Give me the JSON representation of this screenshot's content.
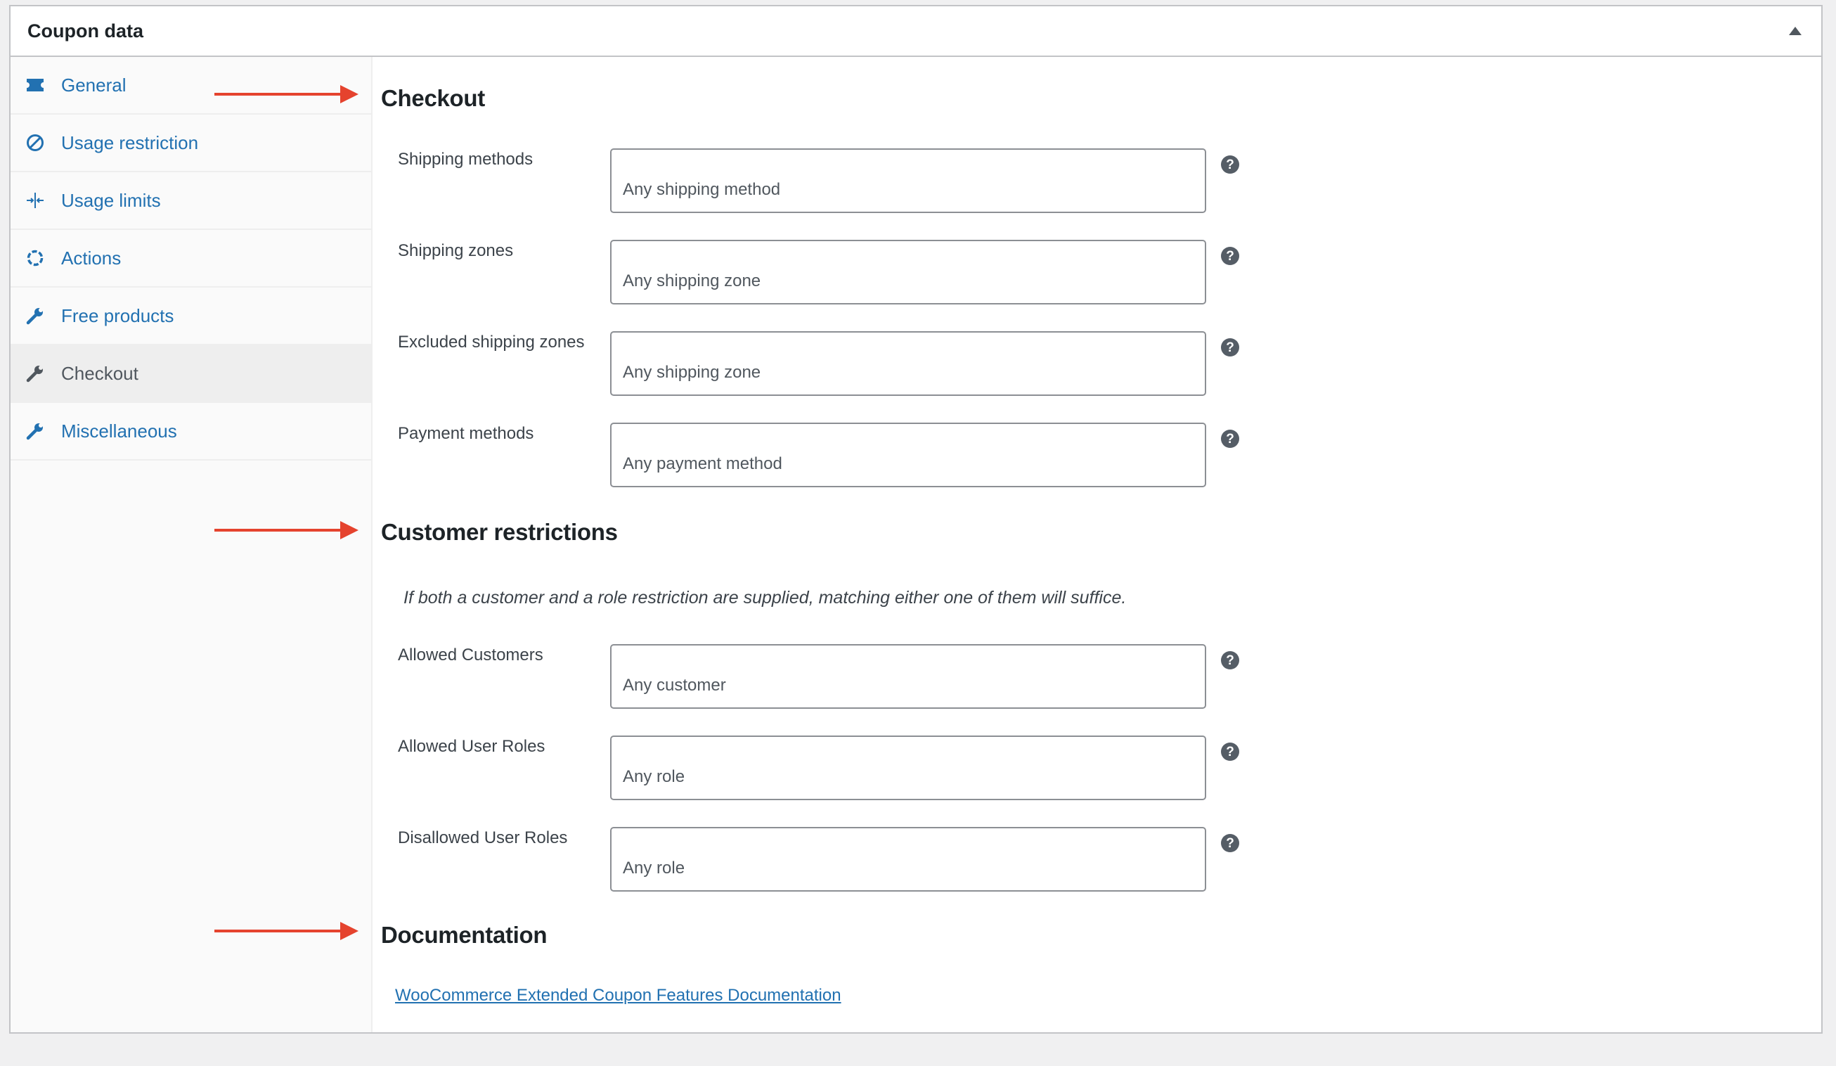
{
  "panel": {
    "title": "Coupon data"
  },
  "tabs": [
    {
      "label": "General",
      "icon": "ticket-icon",
      "active": false
    },
    {
      "label": "Usage restriction",
      "icon": "no-entry-icon",
      "active": false
    },
    {
      "label": "Usage limits",
      "icon": "limits-icon",
      "active": false
    },
    {
      "label": "Actions",
      "icon": "actions-icon",
      "active": false
    },
    {
      "label": "Free products",
      "icon": "wrench-icon",
      "active": false
    },
    {
      "label": "Checkout",
      "icon": "wrench-icon",
      "active": true
    },
    {
      "label": "Miscellaneous",
      "icon": "wrench-icon",
      "active": false
    }
  ],
  "checkout": {
    "heading": "Checkout",
    "fields": [
      {
        "label": "Shipping methods",
        "placeholder": "Any shipping method"
      },
      {
        "label": "Shipping zones",
        "placeholder": "Any shipping zone"
      },
      {
        "label": "Excluded shipping zones",
        "placeholder": "Any shipping zone"
      },
      {
        "label": "Payment methods",
        "placeholder": "Any payment method"
      }
    ]
  },
  "customer_restrictions": {
    "heading": "Customer restrictions",
    "note": "If both a customer and a role restriction are supplied, matching either one of them will suffice.",
    "fields": [
      {
        "label": "Allowed Customers",
        "placeholder": "Any customer"
      },
      {
        "label": "Allowed User Roles",
        "placeholder": "Any role"
      },
      {
        "label": "Disallowed User Roles",
        "placeholder": "Any role"
      }
    ]
  },
  "documentation": {
    "heading": "Documentation",
    "link": "WooCommerce Extended Coupon Features Documentation"
  },
  "help_glyph": "?",
  "colors": {
    "link": "#2271b1",
    "annotation_arrow": "#e5432e",
    "active_tab_bg": "#eeeeee"
  }
}
